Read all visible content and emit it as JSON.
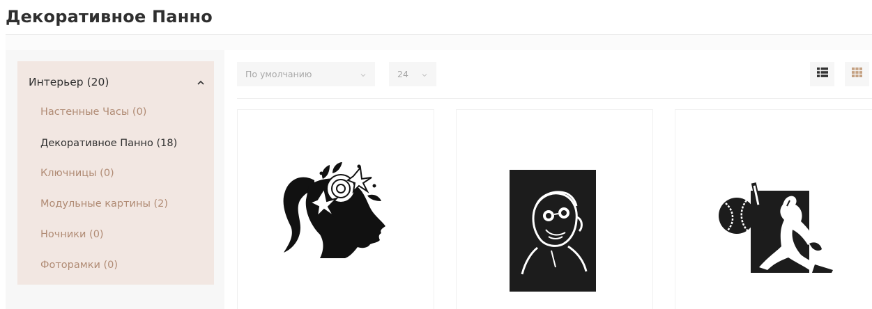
{
  "page": {
    "title": "Декоративное Панно"
  },
  "sidebar": {
    "category": "Интерьер (20)",
    "expanded_icon": "chevron-up-icon",
    "items": [
      {
        "label": "Настенные Часы (0)",
        "active": false
      },
      {
        "label": "Декоративное Панно (18)",
        "active": true
      },
      {
        "label": "Ключницы (0)",
        "active": false
      },
      {
        "label": "Модульные картины (2)",
        "active": false
      },
      {
        "label": "Ночники (0)",
        "active": false
      },
      {
        "label": "Фоторамки (0)",
        "active": false
      }
    ]
  },
  "toolbar": {
    "sort_value": "По умолчанию",
    "per_page_value": "24",
    "list_view_icon": "list-view-icon",
    "grid_view_icon": "grid-view-icon",
    "active_view": "grid"
  },
  "products": [
    {
      "icon": "woman-flower-silhouette-icon"
    },
    {
      "icon": "man-sunglasses-panel-icon"
    },
    {
      "icon": "baseball-player-panel-icon"
    }
  ],
  "colors": {
    "sidebar_bg": "#f2e7e2",
    "link": "#b08b74",
    "active_link": "#2f2f2f",
    "grid_icon": "#c4a182",
    "list_icon": "#333333"
  }
}
